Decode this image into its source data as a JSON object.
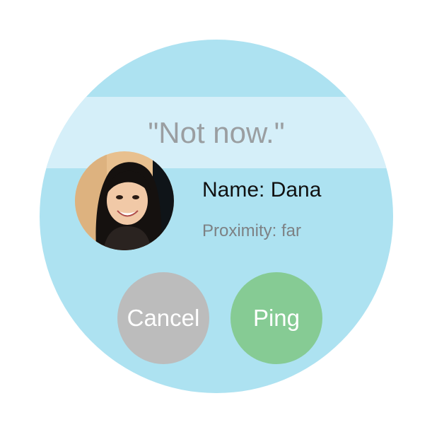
{
  "status": {
    "message": "\"Not now.\""
  },
  "contact": {
    "name_text": "Name: Dana",
    "proximity_text": "Proximity: far",
    "avatar_icon": "contact-photo"
  },
  "actions": {
    "cancel_label": "Cancel",
    "ping_label": "Ping"
  },
  "colors": {
    "watch_background": "#ade2f1",
    "status_band": "#d5eff9",
    "cancel_button": "#bcbcbc",
    "ping_button": "#86cb94"
  }
}
